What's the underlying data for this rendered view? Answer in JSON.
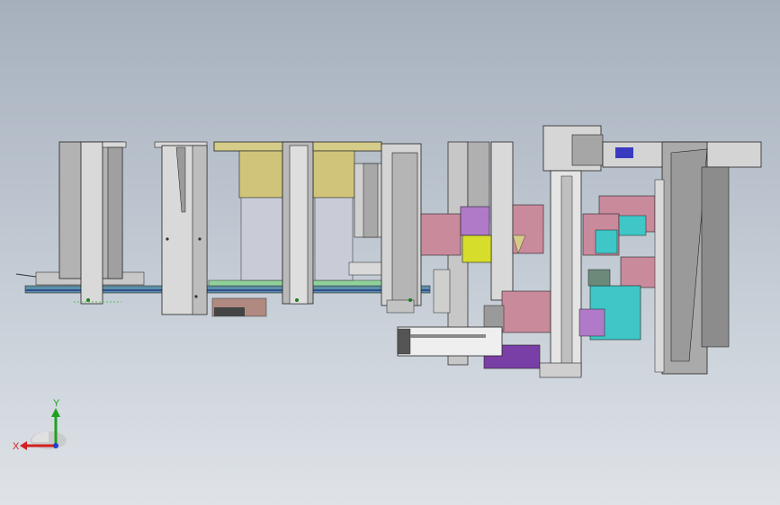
{
  "viewport": {
    "name": "cad-graphics-area",
    "colors": {
      "background_top": "#a6b0bd",
      "background_bottom": "#dfe3e8",
      "frame_gray": "#a9a9a9",
      "frame_light": "#d9d9d9",
      "beige": "#d6cc8a",
      "pink": "#c98a9c",
      "magenta": "#b07ac8",
      "cyan": "#3fc6c6",
      "yellow_green": "#d6dd2a",
      "dark_purple": "#7a3fa6",
      "green_rail": "#8fd19a"
    }
  },
  "triad": {
    "x_label": "X",
    "y_label": "Y",
    "x_color": "#d32020",
    "y_color": "#20a020",
    "z_color": "#2040d0"
  }
}
